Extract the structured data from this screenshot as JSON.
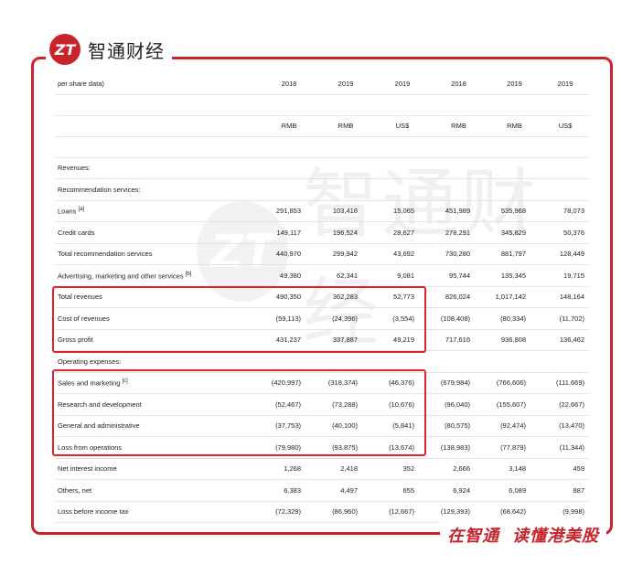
{
  "logo": {
    "mark": "ZT",
    "text": "智通财经"
  },
  "slogan": {
    "part1": "在智通",
    "part2": "读懂港美股"
  },
  "watermark": {
    "text": "智通财经"
  },
  "table": {
    "header_label": "per share data)",
    "years": [
      "2018",
      "2019",
      "2019",
      "2018",
      "2019",
      "2019"
    ],
    "currencies": [
      "RMB",
      "RMB",
      "US$",
      "RMB",
      "RMB",
      "US$"
    ],
    "rows": [
      {
        "label": "Revenues:",
        "values": [
          "",
          "",
          "",
          "",
          "",
          ""
        ]
      },
      {
        "label": "Recommendation services:",
        "values": [
          "",
          "",
          "",
          "",
          "",
          ""
        ]
      },
      {
        "label": "Loans",
        "sup": "[a]",
        "values": [
          "291,853",
          "103,418",
          "15,065",
          "451,989",
          "535,968",
          "78,073"
        ]
      },
      {
        "label": "Credit cards",
        "values": [
          "149,117",
          "196,524",
          "28,627",
          "278,291",
          "345,829",
          "50,376"
        ]
      },
      {
        "label": "Total recommendation services",
        "values": [
          "440,970",
          "299,942",
          "43,692",
          "730,280",
          "881,797",
          "128,449"
        ]
      },
      {
        "label": "Advertising, marketing and other services",
        "sup": "[b]",
        "values": [
          "49,380",
          "62,341",
          "9,081",
          "95,744",
          "135,345",
          "19,715"
        ]
      },
      {
        "label": "Total revenues",
        "values": [
          "490,350",
          "362,283",
          "52,773",
          "826,024",
          "1,017,142",
          "148,164"
        ]
      },
      {
        "label": "Cost of revenues",
        "values": [
          "(59,113)",
          "(24,396)",
          "(3,554)",
          "(108,408)",
          "(80,334)",
          "(11,702)"
        ]
      },
      {
        "label": "Gross profit",
        "values": [
          "431,237",
          "337,887",
          "49,219",
          "717,616",
          "936,808",
          "136,462"
        ]
      },
      {
        "label": "Operating expenses:",
        "values": [
          "",
          "",
          "",
          "",
          "",
          ""
        ]
      },
      {
        "label": "Sales and marketing",
        "sup": "[c]",
        "values": [
          "(420,997)",
          "(318,374)",
          "(46,376)",
          "(679,984)",
          "(766,606)",
          "(111,669)"
        ]
      },
      {
        "label": "Research and development",
        "values": [
          "(52,467)",
          "(73,288)",
          "(10,676)",
          "(96,040)",
          "(155,607)",
          "(22,667)"
        ]
      },
      {
        "label": "General and administrative",
        "values": [
          "(37,753)",
          "(40,100)",
          "(5,841)",
          "(80,575)",
          "(92,474)",
          "(13,470)"
        ]
      },
      {
        "label": "Loss from operations",
        "values": [
          "(79,980)",
          "(93,875)",
          "(13,674)",
          "(138,983)",
          "(77,879)",
          "(11,344)"
        ]
      },
      {
        "label": "Net interest income",
        "values": [
          "1,268",
          "2,418",
          "352",
          "2,666",
          "3,148",
          "459"
        ]
      },
      {
        "label": "Others, net",
        "values": [
          "6,383",
          "4,497",
          "655",
          "6,924",
          "6,089",
          "887"
        ]
      },
      {
        "label": "Loss before income tax",
        "values": [
          "(72,329)",
          "(86,960)",
          "(12,667)",
          "(129,393)",
          "(68,642)",
          "(9,998)"
        ]
      }
    ]
  },
  "colors": {
    "brand_red": "#c8242b",
    "highlight_red": "#e0232e"
  }
}
